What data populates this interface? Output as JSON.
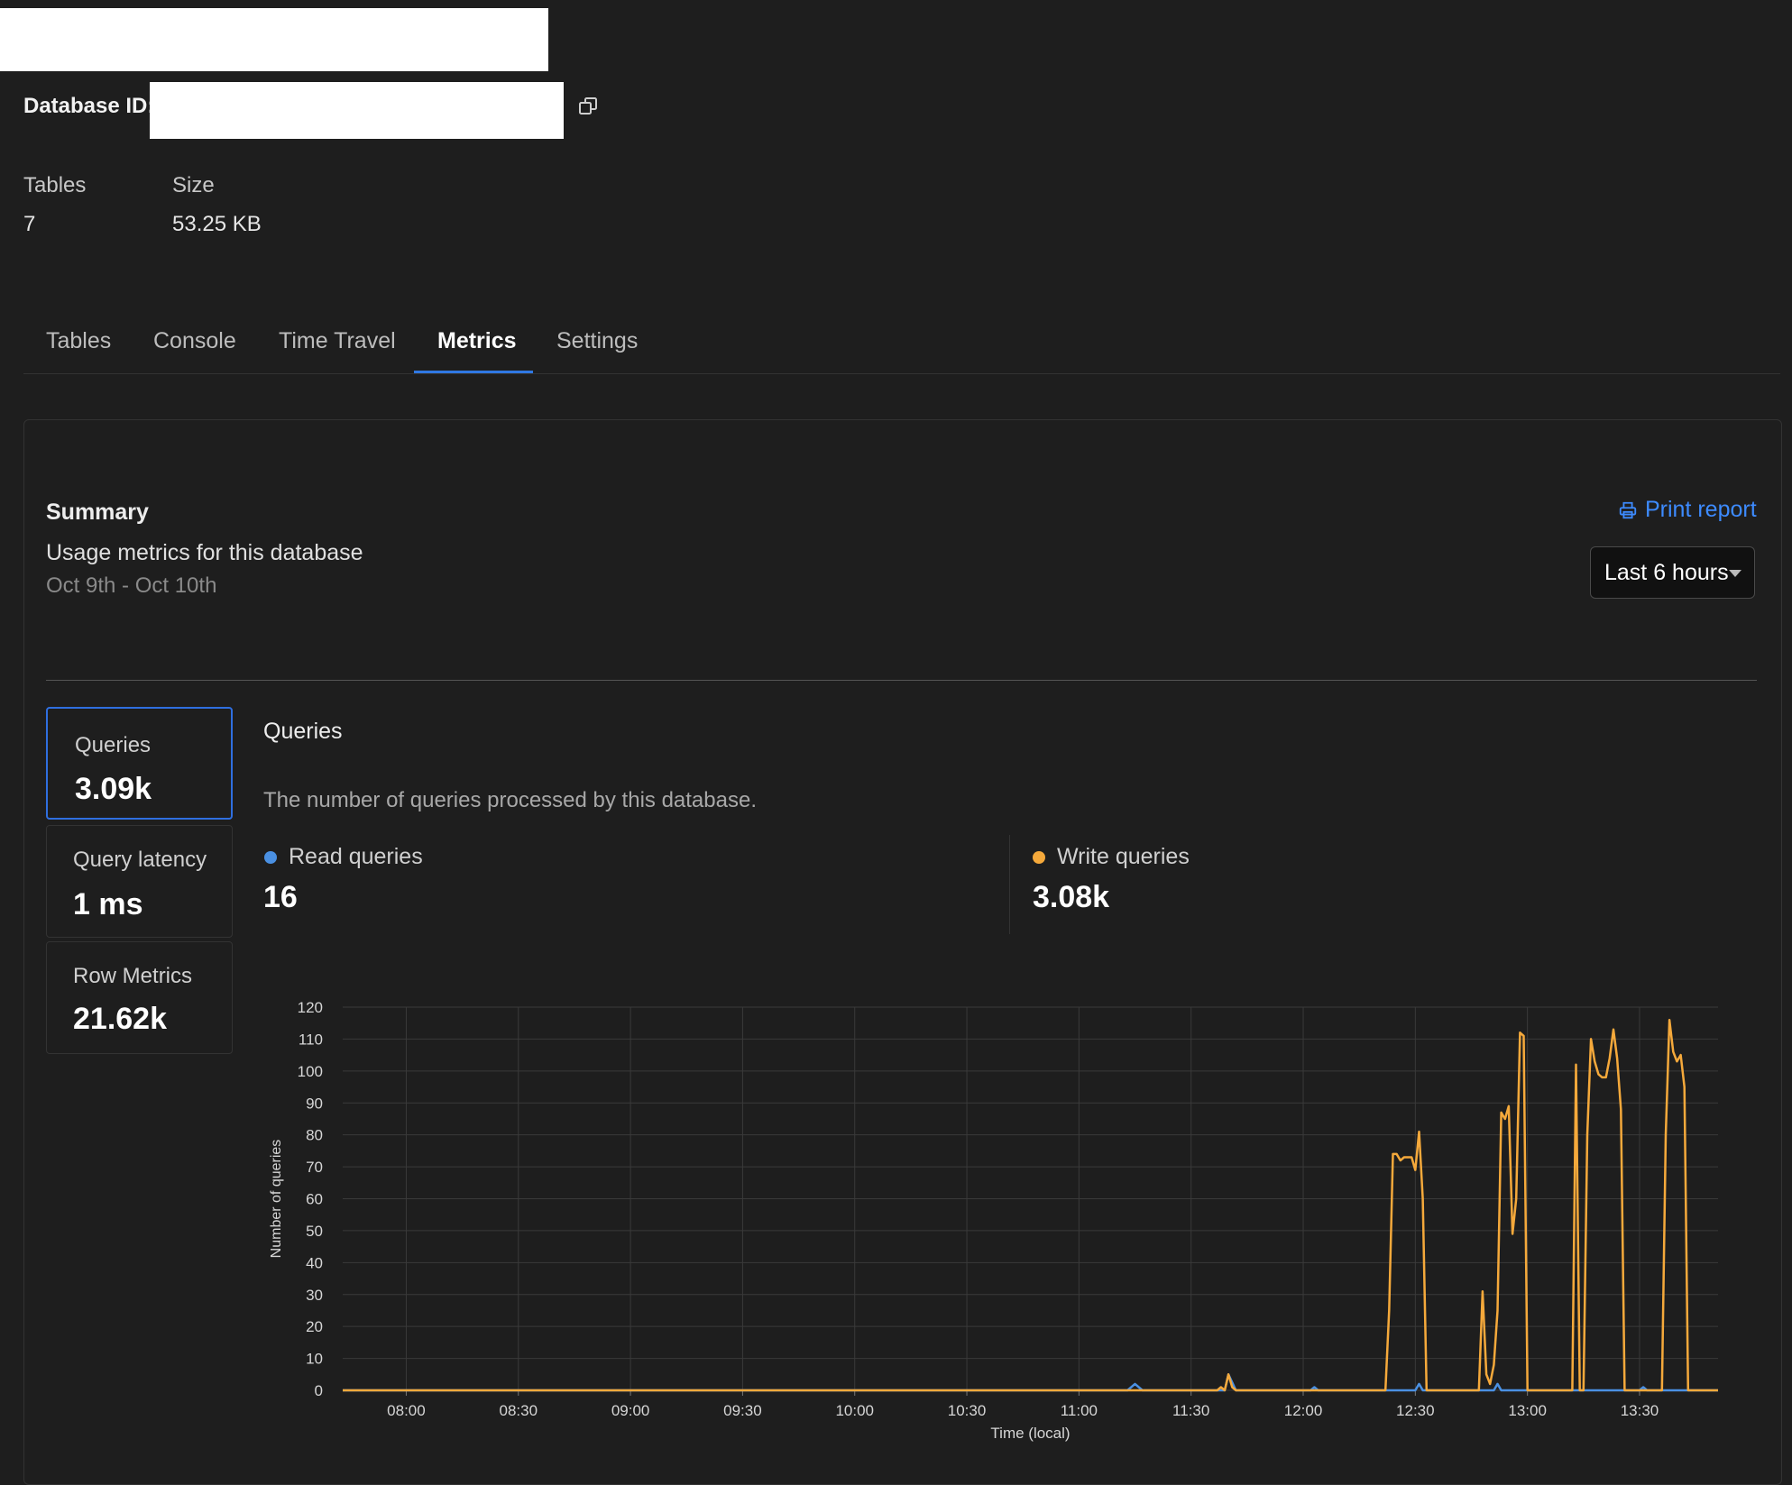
{
  "header": {
    "db_id_label": "Database ID:"
  },
  "stats": {
    "tables_label": "Tables",
    "tables_value": "7",
    "size_label": "Size",
    "size_value": "53.25 KB"
  },
  "tabs": [
    {
      "label": "Tables"
    },
    {
      "label": "Console"
    },
    {
      "label": "Time Travel"
    },
    {
      "label": "Metrics"
    },
    {
      "label": "Settings"
    }
  ],
  "summary": {
    "title": "Summary",
    "subtitle": "Usage metrics for this database",
    "date_range": "Oct 9th - Oct 10th",
    "print_label": "Print report",
    "time_select": "Last 6 hours"
  },
  "metric_cards": [
    {
      "label": "Queries",
      "value": "3.09k"
    },
    {
      "label": "Query latency",
      "value": "1 ms"
    },
    {
      "label": "Row Metrics",
      "value": "21.62k"
    }
  ],
  "queries": {
    "title": "Queries",
    "description": "The number of queries processed by this database.",
    "read_label": "Read queries",
    "read_value": "16",
    "write_label": "Write queries",
    "write_value": "3.08k"
  },
  "colors": {
    "accent": "#2f78e3",
    "read": "#4a90e2",
    "write": "#f5a93b"
  },
  "chart_data": {
    "type": "line",
    "xlabel": "Time (local)",
    "ylabel": "Number of queries",
    "ylim": [
      0,
      120
    ],
    "yticks": [
      0,
      10,
      20,
      30,
      40,
      50,
      60,
      70,
      80,
      90,
      100,
      110,
      120
    ],
    "xlim": [
      "07:43",
      "13:51"
    ],
    "xticks": [
      "08:00",
      "08:30",
      "09:00",
      "09:30",
      "10:00",
      "10:30",
      "11:00",
      "11:30",
      "12:00",
      "12:30",
      "13:00",
      "13:30"
    ],
    "grid": true,
    "series": [
      {
        "name": "Read queries",
        "color": "#4a90e2",
        "points": [
          [
            "07:43",
            0
          ],
          [
            "11:13",
            0
          ],
          [
            "11:15",
            2
          ],
          [
            "11:17",
            0
          ],
          [
            "11:39",
            0
          ],
          [
            "11:40",
            5
          ],
          [
            "11:42",
            0
          ],
          [
            "12:02",
            0
          ],
          [
            "12:03",
            1
          ],
          [
            "12:04",
            0
          ],
          [
            "12:30",
            0
          ],
          [
            "12:31",
            2
          ],
          [
            "12:32",
            0
          ],
          [
            "12:51",
            0
          ],
          [
            "12:52",
            2
          ],
          [
            "12:53",
            0
          ],
          [
            "13:30",
            0
          ],
          [
            "13:31",
            1
          ],
          [
            "13:32",
            0
          ],
          [
            "13:51",
            0
          ]
        ]
      },
      {
        "name": "Write queries",
        "color": "#f5a93b",
        "points": [
          [
            "07:43",
            0
          ],
          [
            "11:37",
            0
          ],
          [
            "11:38",
            1
          ],
          [
            "11:39",
            0
          ],
          [
            "11:40",
            5
          ],
          [
            "11:41",
            1
          ],
          [
            "11:42",
            0
          ],
          [
            "12:22",
            0
          ],
          [
            "12:23",
            25
          ],
          [
            "12:24",
            74
          ],
          [
            "12:25",
            74
          ],
          [
            "12:26",
            72
          ],
          [
            "12:27",
            73
          ],
          [
            "12:28",
            73
          ],
          [
            "12:29",
            73
          ],
          [
            "12:30",
            69
          ],
          [
            "12:31",
            81
          ],
          [
            "12:32",
            60
          ],
          [
            "12:33",
            0
          ],
          [
            "12:47",
            0
          ],
          [
            "12:48",
            31
          ],
          [
            "12:49",
            5
          ],
          [
            "12:50",
            2
          ],
          [
            "12:51",
            8
          ],
          [
            "12:52",
            25
          ],
          [
            "12:53",
            87
          ],
          [
            "12:54",
            85
          ],
          [
            "12:55",
            89
          ],
          [
            "12:56",
            49
          ],
          [
            "12:57",
            60
          ],
          [
            "12:58",
            112
          ],
          [
            "12:59",
            111
          ],
          [
            "13:00",
            0
          ],
          [
            "13:12",
            0
          ],
          [
            "13:13",
            102
          ],
          [
            "13:14",
            0
          ],
          [
            "13:15",
            0
          ],
          [
            "13:16",
            80
          ],
          [
            "13:17",
            110
          ],
          [
            "13:18",
            103
          ],
          [
            "13:19",
            99
          ],
          [
            "13:20",
            98
          ],
          [
            "13:21",
            98
          ],
          [
            "13:22",
            104
          ],
          [
            "13:23",
            113
          ],
          [
            "13:24",
            104
          ],
          [
            "13:25",
            88
          ],
          [
            "13:26",
            0
          ],
          [
            "13:36",
            0
          ],
          [
            "13:37",
            80
          ],
          [
            "13:38",
            116
          ],
          [
            "13:39",
            106
          ],
          [
            "13:40",
            103
          ],
          [
            "13:41",
            105
          ],
          [
            "13:42",
            95
          ],
          [
            "13:43",
            0
          ],
          [
            "13:51",
            0
          ]
        ]
      }
    ]
  }
}
